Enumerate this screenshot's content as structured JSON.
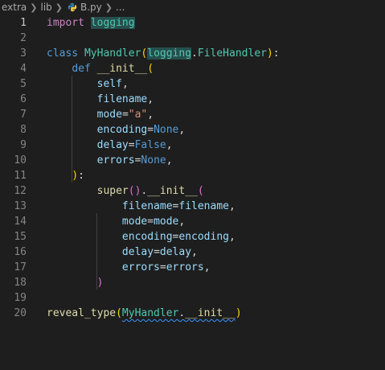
{
  "breadcrumb": {
    "items": [
      "extra",
      "lib",
      "B.py",
      "..."
    ]
  },
  "editor": {
    "line_numbers": [
      "1",
      "2",
      "3",
      "4",
      "5",
      "6",
      "7",
      "8",
      "9",
      "10",
      "11",
      "12",
      "13",
      "14",
      "15",
      "16",
      "17",
      "18",
      "19",
      "20"
    ],
    "active_line": "1",
    "lines": [
      [
        "import",
        "logging"
      ],
      [],
      [
        "class",
        "MyHandler",
        "(",
        "logging",
        ".",
        "FileHandler",
        ")",
        ":"
      ],
      [
        "def",
        "__init__",
        "("
      ],
      [
        "self",
        ","
      ],
      [
        "filename",
        ","
      ],
      [
        "mode",
        "=",
        "\"a\"",
        ","
      ],
      [
        "encoding",
        "=",
        "None",
        ","
      ],
      [
        "delay",
        "=",
        "False",
        ","
      ],
      [
        "errors",
        "=",
        "None",
        ","
      ],
      [
        ")",
        ":"
      ],
      [
        "super",
        "()",
        ".",
        "__init__",
        "("
      ],
      [
        "filename",
        "=",
        "filename",
        ","
      ],
      [
        "mode",
        "=",
        "mode",
        ","
      ],
      [
        "encoding",
        "=",
        "encoding",
        ","
      ],
      [
        "delay",
        "=",
        "delay",
        ","
      ],
      [
        "errors",
        "=",
        "errors",
        ","
      ],
      [
        ")"
      ],
      [],
      [
        "reveal_type",
        "(",
        "MyHandler",
        ".",
        "__init__",
        ")"
      ]
    ]
  },
  "colors": {
    "background": "#1e1e1e",
    "keyword": "#569cd6",
    "class": "#4ec9b0",
    "function": "#dcdcaa",
    "parameter": "#9cdcfe",
    "string": "#ce9178",
    "bracket_level1": "#ffd700",
    "bracket_level2": "#da70d6"
  }
}
